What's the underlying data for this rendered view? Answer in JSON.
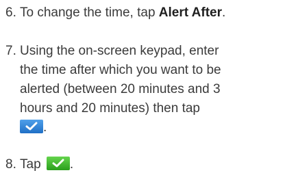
{
  "steps": [
    {
      "number": "6.",
      "text_before": "To change the time, tap ",
      "bold": "Alert After",
      "text_after": "."
    },
    {
      "number": "7.",
      "line1": "Using the on-screen keypad, enter",
      "line2": "the time after which you want to be",
      "line3": "alerted (between 20 minutes and 3",
      "line4": "hours and 20 minutes) then tap",
      "line5_after_icon": ".",
      "icon": "checkmark-icon",
      "icon_color": "#2b7fd8"
    },
    {
      "number": "8.",
      "text_before": "Tap ",
      "text_after": ".",
      "icon": "checkmark-icon",
      "icon_color": "#3cb52a"
    }
  ]
}
